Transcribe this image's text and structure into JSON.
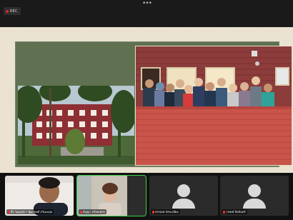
{
  "recording": {
    "label": "REC"
  },
  "toolbar": {
    "more_icon": "more-dots-icon"
  },
  "share": {
    "left_photo": "building-photo",
    "right_photo": "group-photo"
  },
  "participants": [
    {
      "name": "ธีร วัฒนสุข • พุฒาพงศ์ อวิเมฆบุ่ม",
      "muted": true
    },
    {
      "name": "ธัญญา สร้อยเพชร",
      "muted": true,
      "active": true
    },
    {
      "name": "พรรณพ สังขะเนียม",
      "muted": true
    },
    {
      "name": "วรพงษ์ จิตจันทร์",
      "muted": true
    }
  ],
  "scroll": {
    "left_icon": "chevron-left-icon",
    "right_icon": "chevron-right-icon"
  }
}
